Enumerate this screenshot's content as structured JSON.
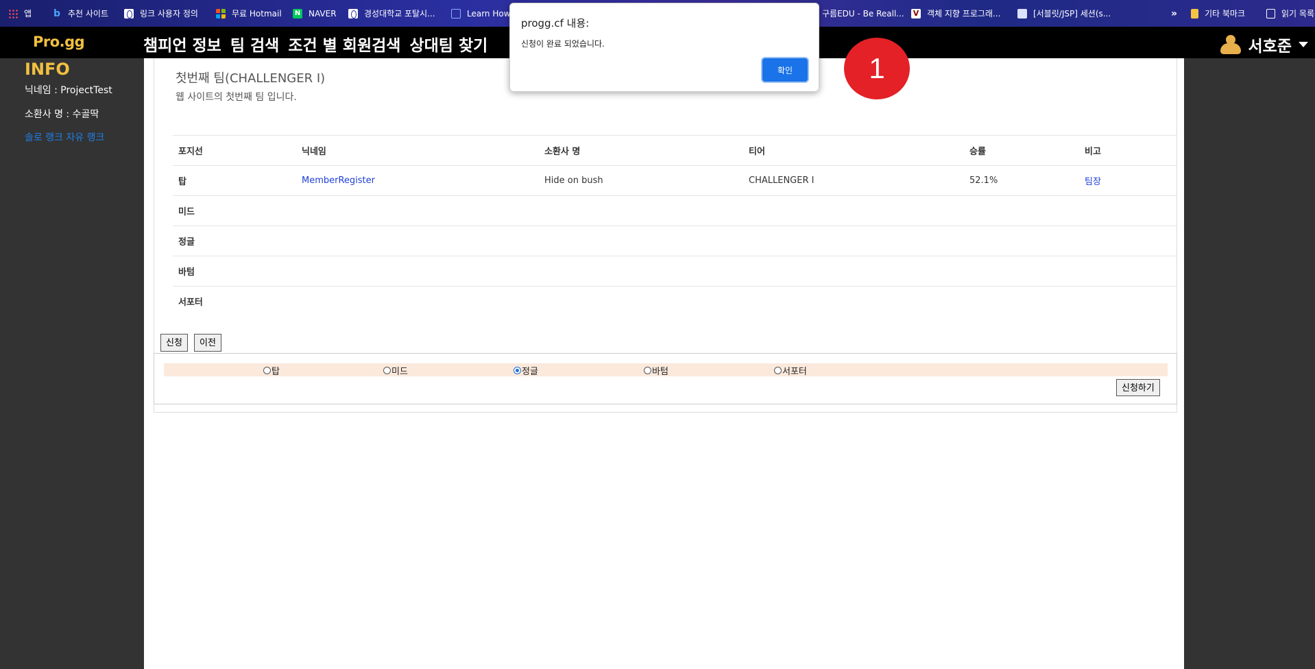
{
  "bookmarks": {
    "items": [
      {
        "label": "앱",
        "icon": "apps-grid-icon"
      },
      {
        "label": "추천 사이트",
        "icon": "bing-icon"
      },
      {
        "label": "링크 사용자 정의",
        "icon": "globe-icon"
      },
      {
        "label": "무료 Hotmail",
        "icon": "microsoft-icon"
      },
      {
        "label": "NAVER",
        "icon": "naver-icon"
      },
      {
        "label": "경성대학교 포탈시...",
        "icon": "globe-icon"
      },
      {
        "label": "Learn How t",
        "icon": "document-icon"
      }
    ],
    "right_items": [
      {
        "label": "구름EDU - Be Reall...",
        "icon": ""
      },
      {
        "label": "객체 지향 프로그래...",
        "icon": "v-icon"
      },
      {
        "label": "[서블릿/JSP] 세션(s...",
        "icon": "blog-icon"
      }
    ],
    "overflow": "»",
    "other_bookmarks": "기타 북마크",
    "reading_list": "읽기 목록"
  },
  "header": {
    "logo": "Pro.gg",
    "nav": [
      "챔피언 정보",
      "팀 검색",
      "조건 별 회원검색",
      "상대팀 찾기"
    ],
    "user_name": "서호준"
  },
  "sidebar": {
    "title": "INFO",
    "nickname": "닉네임 : ProjectTest",
    "summoner": "소환사 명 : 수골딱",
    "rank_link": "솔로 랭크 자유 랭크"
  },
  "team": {
    "title": "첫번째 팀(CHALLENGER I)",
    "subtitle": "웹 사이트의 첫번째 팀 입니다."
  },
  "roster": {
    "headers": [
      "포지선",
      "닉네임",
      "소환사 명",
      "티어",
      "승률",
      "비고"
    ],
    "rows": [
      {
        "position": "탑",
        "nickname": "MemberRegister",
        "summoner": "Hide on bush",
        "tier": "CHALLENGER I",
        "winrate": "52.1%",
        "note": "팀장"
      },
      {
        "position": "미드",
        "nickname": "",
        "summoner": "",
        "tier": "",
        "winrate": "",
        "note": ""
      },
      {
        "position": "정글",
        "nickname": "",
        "summoner": "",
        "tier": "",
        "winrate": "",
        "note": ""
      },
      {
        "position": "바텀",
        "nickname": "",
        "summoner": "",
        "tier": "",
        "winrate": "",
        "note": ""
      },
      {
        "position": "서포터",
        "nickname": "",
        "summoner": "",
        "tier": "",
        "winrate": "",
        "note": ""
      }
    ]
  },
  "buttons": {
    "apply": "신청",
    "prev": "이전",
    "submit": "신청하기"
  },
  "position_options": [
    {
      "label": "탑",
      "checked": false
    },
    {
      "label": "미드",
      "checked": false
    },
    {
      "label": "정글",
      "checked": true
    },
    {
      "label": "바텀",
      "checked": false
    },
    {
      "label": "서포터",
      "checked": false
    }
  ],
  "dialog": {
    "title": "progg.cf 내용:",
    "message": "신청이 완료 되었습니다.",
    "ok": "확인"
  },
  "step_badge": "1",
  "colors": {
    "accent_gold": "#f0c040",
    "link_blue": "#1e3fd6",
    "dialog_button": "#1a73e8",
    "badge_red": "#e32126"
  }
}
